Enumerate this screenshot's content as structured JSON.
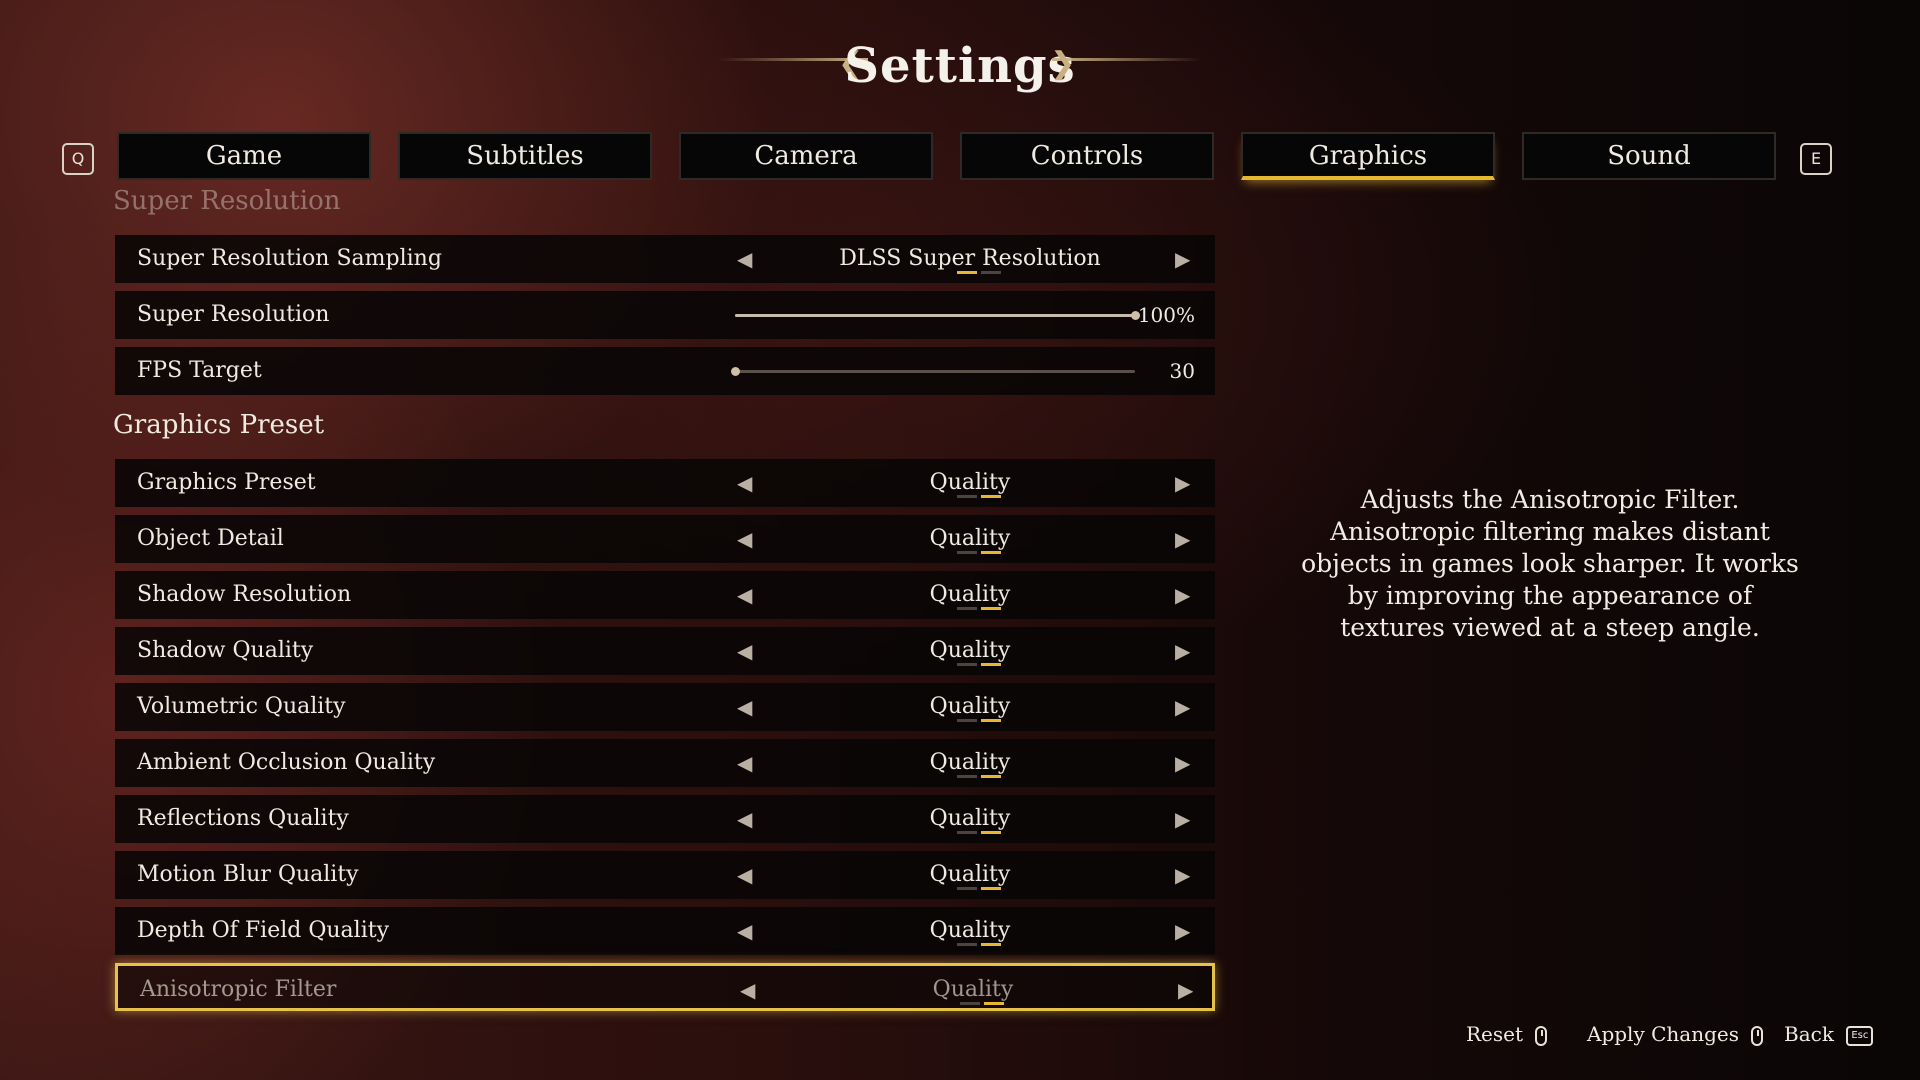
{
  "title": "Settings",
  "tab_keys": {
    "prev": "Q",
    "next": "E"
  },
  "tabs": [
    {
      "label": "Game",
      "active": false
    },
    {
      "label": "Subtitles",
      "active": false
    },
    {
      "label": "Camera",
      "active": false
    },
    {
      "label": "Controls",
      "active": false
    },
    {
      "label": "Graphics",
      "active": true
    },
    {
      "label": "Sound",
      "active": false
    }
  ],
  "sections": {
    "super_resolution": {
      "header": "Super Resolution",
      "rows": {
        "sampling": {
          "label": "Super Resolution Sampling",
          "value": "DLSS Super Resolution"
        },
        "scale": {
          "label": "Super Resolution",
          "value": "100%",
          "level": 1.0
        },
        "fps": {
          "label": "FPS Target",
          "value": "30",
          "level": 0.0
        }
      }
    },
    "graphics_preset": {
      "header": "Graphics Preset",
      "rows": [
        {
          "label": "Graphics Preset",
          "value": "Quality"
        },
        {
          "label": "Object Detail",
          "value": "Quality"
        },
        {
          "label": "Shadow Resolution",
          "value": "Quality"
        },
        {
          "label": "Shadow Quality",
          "value": "Quality"
        },
        {
          "label": "Volumetric Quality",
          "value": "Quality"
        },
        {
          "label": "Ambient Occlusion Quality",
          "value": "Quality"
        },
        {
          "label": "Reflections Quality",
          "value": "Quality"
        },
        {
          "label": "Motion Blur Quality",
          "value": "Quality"
        },
        {
          "label": "Depth Of Field Quality",
          "value": "Quality"
        },
        {
          "label": "Anisotropic Filter",
          "value": "Quality",
          "selected": true
        }
      ]
    }
  },
  "description": "Adjusts the Anisotropic Filter. Anisotropic filtering makes distant objects in games look sharper. It works by improving the appearance of textures viewed at a steep angle.",
  "footer": {
    "reset": "Reset",
    "apply": "Apply Changes",
    "back": "Back",
    "back_key": "Esc"
  },
  "colors": {
    "accent": "#e6b832",
    "panel": "#080606"
  }
}
